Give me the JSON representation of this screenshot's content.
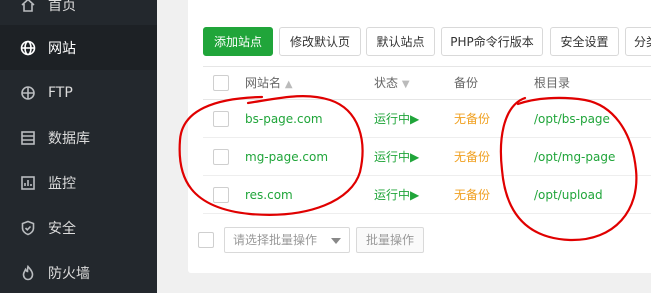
{
  "sidebar": {
    "items": [
      {
        "label": "首页",
        "icon": "home-icon"
      },
      {
        "label": "网站",
        "icon": "globe-icon",
        "active": true
      },
      {
        "label": "FTP",
        "icon": "ftp-icon"
      },
      {
        "label": "数据库",
        "icon": "database-icon"
      },
      {
        "label": "监控",
        "icon": "monitor-icon"
      },
      {
        "label": "安全",
        "icon": "shield-icon"
      },
      {
        "label": "防火墙",
        "icon": "firewall-icon"
      }
    ]
  },
  "toolbar": {
    "add_site": "添加站点",
    "edit_default_page": "修改默认页",
    "default_site": "默认站点",
    "php_cli_version": "PHP命令行版本",
    "security_settings": "安全设置",
    "category": "分类"
  },
  "table": {
    "headers": {
      "site_name": "网站名",
      "status": "状态",
      "backup": "备份",
      "root": "根目录"
    },
    "rows": [
      {
        "site": "bs-page.com",
        "status": "运行中▶",
        "backup": "无备份",
        "root": "/opt/bs-page"
      },
      {
        "site": "mg-page.com",
        "status": "运行中▶",
        "backup": "无备份",
        "root": "/opt/mg-page"
      },
      {
        "site": "res.com",
        "status": "运行中▶",
        "backup": "无备份",
        "root": "/opt/upload"
      }
    ]
  },
  "footer": {
    "batch_select_placeholder": "请选择批量操作",
    "batch_button": "批量操作"
  },
  "colors": {
    "sidebar_bg": "#23282d",
    "accent_green": "#20a53a",
    "backup_orange": "#f0a020",
    "annotation_red": "#e00000"
  }
}
